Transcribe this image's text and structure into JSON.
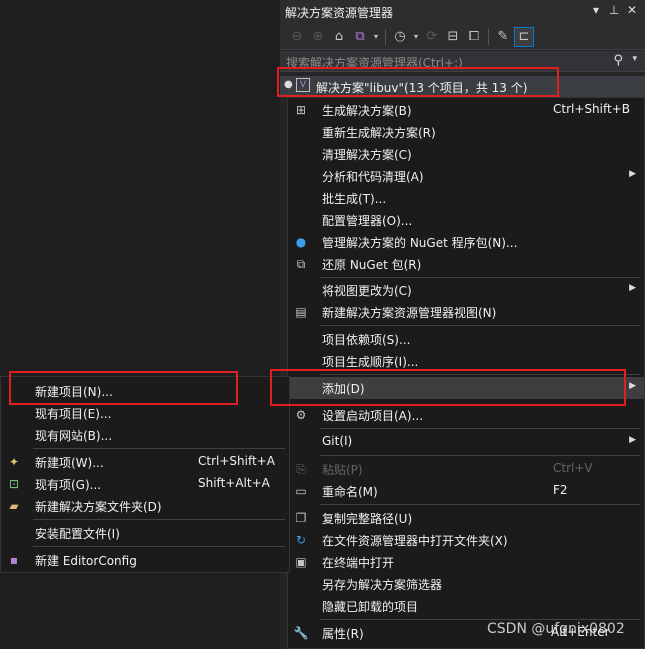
{
  "solution_explorer": {
    "title": "解决方案资源管理器",
    "title_buttons": [
      "▾",
      "⊥",
      "✕"
    ],
    "search_placeholder": "搜索解决方案资源管理器(Ctrl+;)",
    "solution_label": "解决方案\"libuv\"(13 个项目，共 13 个)"
  },
  "main_menu": {
    "build_solution": {
      "label": "生成解决方案(B)",
      "shortcut": "Ctrl+Shift+B"
    },
    "rebuild_solution": {
      "label": "重新生成解决方案(R)"
    },
    "clean_solution": {
      "label": "清理解决方案(C)"
    },
    "analyze": {
      "label": "分析和代码清理(A)"
    },
    "batch_build": {
      "label": "批生成(T)..."
    },
    "config_manager": {
      "label": "配置管理器(O)..."
    },
    "manage_nuget": {
      "label": "管理解决方案的 NuGet 程序包(N)..."
    },
    "restore_nuget": {
      "label": "还原 NuGet 包(R)"
    },
    "change_view": {
      "label": "将视图更改为(C)"
    },
    "new_view": {
      "label": "新建解决方案资源管理器视图(N)"
    },
    "project_deps": {
      "label": "项目依赖项(S)..."
    },
    "build_order": {
      "label": "项目生成顺序(I)..."
    },
    "add": {
      "label": "添加(D)"
    },
    "startup_projects": {
      "label": "设置启动项目(A)..."
    },
    "git": {
      "label": "Git(I)"
    },
    "paste": {
      "label": "粘贴(P)",
      "shortcut": "Ctrl+V"
    },
    "rename": {
      "label": "重命名(M)",
      "shortcut": "F2"
    },
    "copy_path": {
      "label": "复制完整路径(U)"
    },
    "open_in_explorer": {
      "label": "在文件资源管理器中打开文件夹(X)"
    },
    "open_in_terminal": {
      "label": "在终端中打开"
    },
    "save_as_filter": {
      "label": "另存为解决方案筛选器"
    },
    "hide_unloaded": {
      "label": "隐藏已卸载的项目"
    },
    "properties": {
      "label": "属性(R)",
      "shortcut": "Alt+Enter"
    }
  },
  "sub_menu": {
    "new_project": {
      "label": "新建项目(N)..."
    },
    "existing_project": {
      "label": "现有项目(E)..."
    },
    "existing_website": {
      "label": "现有网站(B)..."
    },
    "new_item": {
      "label": "新建项(W)...",
      "shortcut": "Ctrl+Shift+A"
    },
    "existing_item": {
      "label": "现有项(G)...",
      "shortcut": "Shift+Alt+A"
    },
    "new_solution_folder": {
      "label": "新建解决方案文件夹(D)"
    },
    "install_config": {
      "label": "安装配置文件(I)"
    },
    "new_editorconfig": {
      "label": "新建 EditorConfig"
    }
  },
  "watermark": "CSDN @ufgnix0802",
  "colors": {
    "highlight_box": "#e02020",
    "menu_bg": "#1b1b1c",
    "accent": "#007acc"
  }
}
